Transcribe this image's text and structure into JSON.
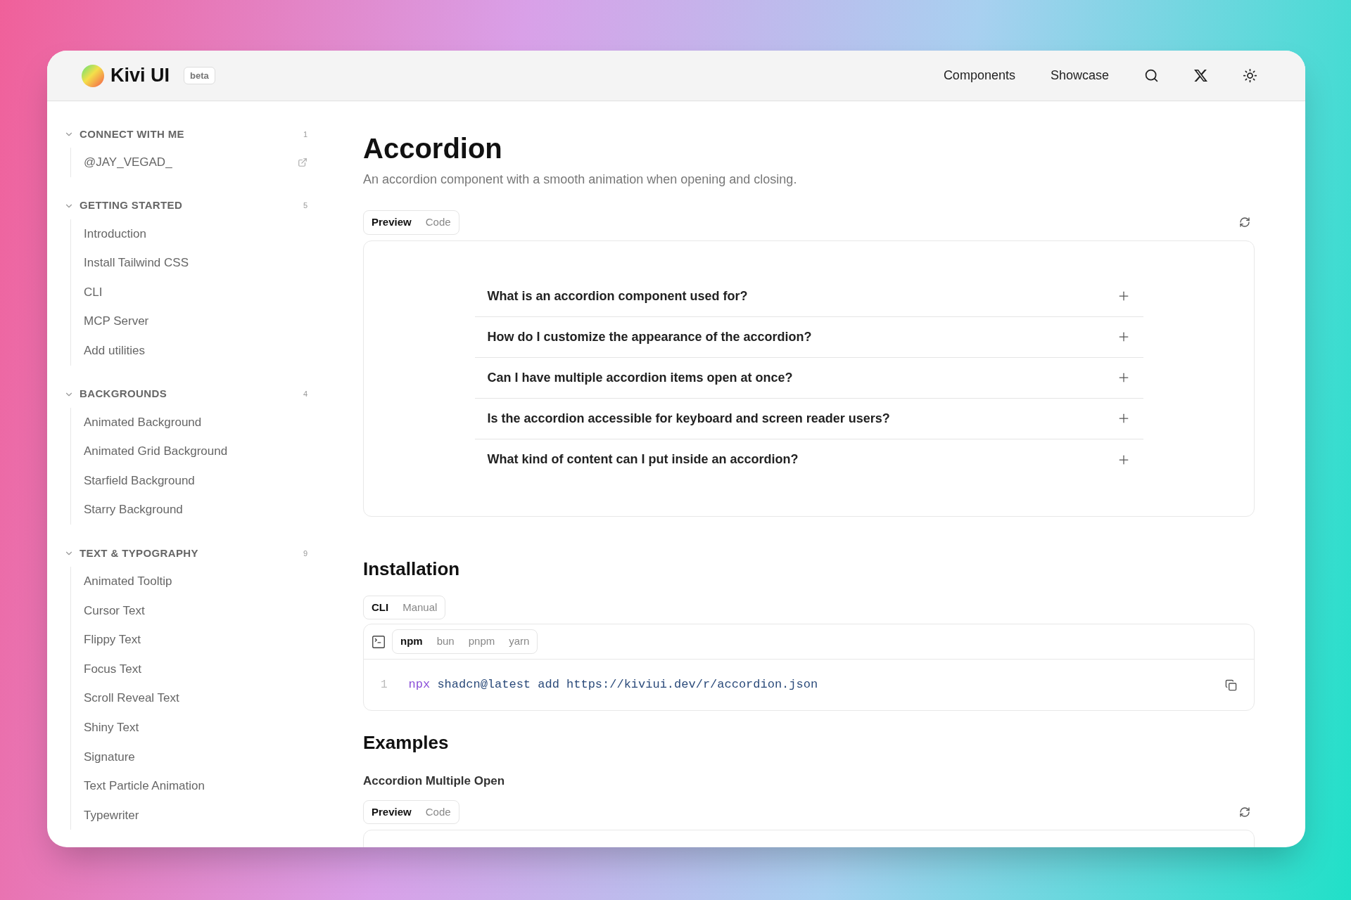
{
  "brand": {
    "name": "Kivi UI",
    "badge": "beta"
  },
  "nav": {
    "links": [
      "Components",
      "Showcase"
    ]
  },
  "sidebar": {
    "sections": [
      {
        "title": "CONNECT WITH ME",
        "count": "1",
        "expanded": true,
        "items": [
          {
            "label": "@JAY_VEGAD_",
            "external": true
          }
        ]
      },
      {
        "title": "GETTING STARTED",
        "count": "5",
        "expanded": true,
        "items": [
          {
            "label": "Introduction",
            "external": false
          },
          {
            "label": "Install Tailwind CSS",
            "external": false
          },
          {
            "label": "CLI",
            "external": false
          },
          {
            "label": "MCP Server",
            "external": false
          },
          {
            "label": "Add utilities",
            "external": false
          }
        ]
      },
      {
        "title": "BACKGROUNDS",
        "count": "4",
        "expanded": true,
        "items": [
          {
            "label": "Animated Background",
            "external": false
          },
          {
            "label": "Animated Grid Background",
            "external": false
          },
          {
            "label": "Starfield Background",
            "external": false
          },
          {
            "label": "Starry Background",
            "external": false
          }
        ]
      },
      {
        "title": "TEXT & TYPOGRAPHY",
        "count": "9",
        "expanded": true,
        "items": [
          {
            "label": "Animated Tooltip",
            "external": false
          },
          {
            "label": "Cursor Text",
            "external": false
          },
          {
            "label": "Flippy Text",
            "external": false
          },
          {
            "label": "Focus Text",
            "external": false
          },
          {
            "label": "Scroll Reveal Text",
            "external": false
          },
          {
            "label": "Shiny Text",
            "external": false
          },
          {
            "label": "Signature",
            "external": false
          },
          {
            "label": "Text Particle Animation",
            "external": false
          },
          {
            "label": "Typewriter",
            "external": false
          }
        ]
      }
    ]
  },
  "page": {
    "title": "Accordion",
    "description": "An accordion component with a smooth animation when opening and closing.",
    "preview_tabs": [
      {
        "label": "Preview",
        "selected": true
      },
      {
        "label": "Code",
        "selected": false
      }
    ],
    "accordion": [
      {
        "question": "What is an accordion component used for?",
        "expanded": false
      },
      {
        "question": "How do I customize the appearance of the accordion?",
        "expanded": false
      },
      {
        "question": "Can I have multiple accordion items open at once?",
        "expanded": false
      },
      {
        "question": "Is the accordion accessible for keyboard and screen reader users?",
        "expanded": false
      },
      {
        "question": "What kind of content can I put inside an accordion?",
        "expanded": false
      }
    ],
    "installation": {
      "heading": "Installation",
      "method_tabs": [
        {
          "label": "CLI",
          "selected": true
        },
        {
          "label": "Manual",
          "selected": false
        }
      ],
      "package_tabs": [
        {
          "label": "npm",
          "selected": true
        },
        {
          "label": "bun",
          "selected": false
        },
        {
          "label": "pnpm",
          "selected": false
        },
        {
          "label": "yarn",
          "selected": false
        }
      ],
      "code": {
        "line_number": "1",
        "command": "npx",
        "args": "shadcn@latest add https://kiviui.dev/r/accordion.json"
      }
    },
    "examples": {
      "heading": "Examples",
      "items": [
        {
          "title": "Accordion Multiple Open",
          "tabs": [
            {
              "label": "Preview",
              "selected": true
            },
            {
              "label": "Code",
              "selected": false
            }
          ]
        }
      ]
    }
  }
}
